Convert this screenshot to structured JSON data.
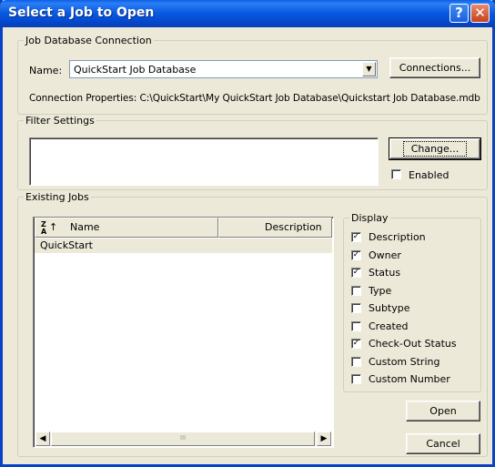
{
  "window": {
    "title": "Select a Job to Open",
    "help_glyph": "?",
    "close_glyph": "✕"
  },
  "connection": {
    "legend": "Job Database Connection",
    "name_label": "Name:",
    "database_value": "QuickStart Job Database",
    "connections_button": "Connections...",
    "properties_text": "Connection Properties: C:\\QuickStart\\My QuickStart Job Database\\Quickstart Job Database.mdb"
  },
  "filter": {
    "legend": "Filter Settings",
    "change_button": "Change...",
    "enabled_label": "Enabled",
    "enabled_checked": false
  },
  "jobs": {
    "legend": "Existing Jobs",
    "sort_icon_glyph": "Z↑A",
    "columns": [
      "Name",
      "Description"
    ],
    "rows": [
      {
        "name": "QuickStart",
        "description": ""
      }
    ],
    "scroll_thumb_glyph": "III"
  },
  "display": {
    "legend": "Display",
    "options": [
      {
        "label": "Description",
        "checked": true
      },
      {
        "label": "Owner",
        "checked": true
      },
      {
        "label": "Status",
        "checked": true
      },
      {
        "label": "Type",
        "checked": false
      },
      {
        "label": "Subtype",
        "checked": false
      },
      {
        "label": "Created",
        "checked": false
      },
      {
        "label": "Check-Out Status",
        "checked": true
      },
      {
        "label": "Custom String",
        "checked": false
      },
      {
        "label": "Custom Number",
        "checked": false
      }
    ]
  },
  "actions": {
    "open_button": "Open",
    "cancel_button": "Cancel"
  },
  "colors": {
    "titlebar": "#0858e0",
    "dialog_bg": "#ece9d8",
    "selection": "#ece9d8"
  }
}
